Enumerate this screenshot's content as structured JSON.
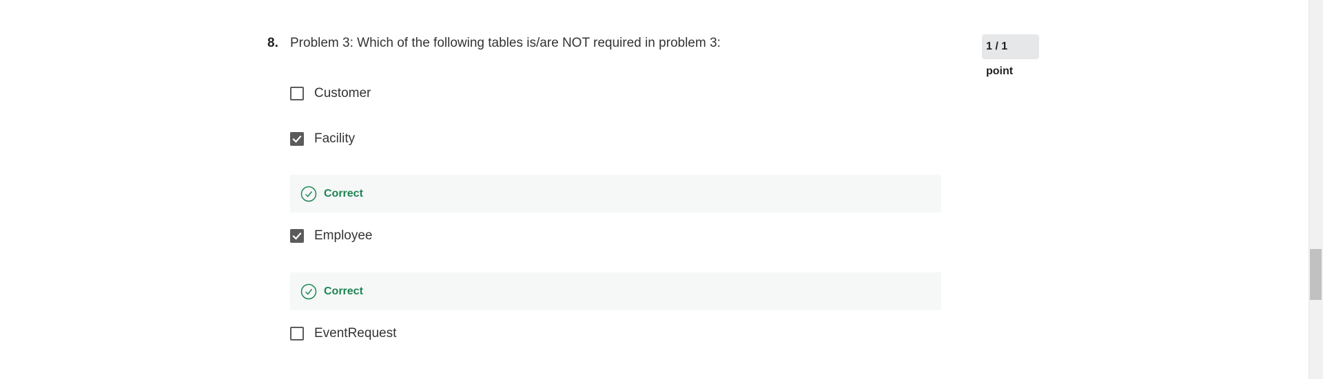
{
  "question": {
    "number": "8.",
    "text": "Problem 3: Which of the following tables is/are NOT required in problem 3:",
    "points": "1 / 1 point"
  },
  "options": [
    {
      "label": "Customer",
      "checked": false
    },
    {
      "label": "Facility",
      "checked": true,
      "feedback": "Correct"
    },
    {
      "label": "Employee",
      "checked": true,
      "feedback": "Correct"
    },
    {
      "label": "EventRequest",
      "checked": false
    }
  ],
  "icons": {
    "checkbox_checked": "checkmark-icon",
    "feedback": "check-circle-icon"
  },
  "colors": {
    "correct": "#1f8354",
    "checkbox": "#5b5b5b",
    "feedback_bg": "#f5f8f7",
    "points_bg": "#e5e7e8"
  }
}
